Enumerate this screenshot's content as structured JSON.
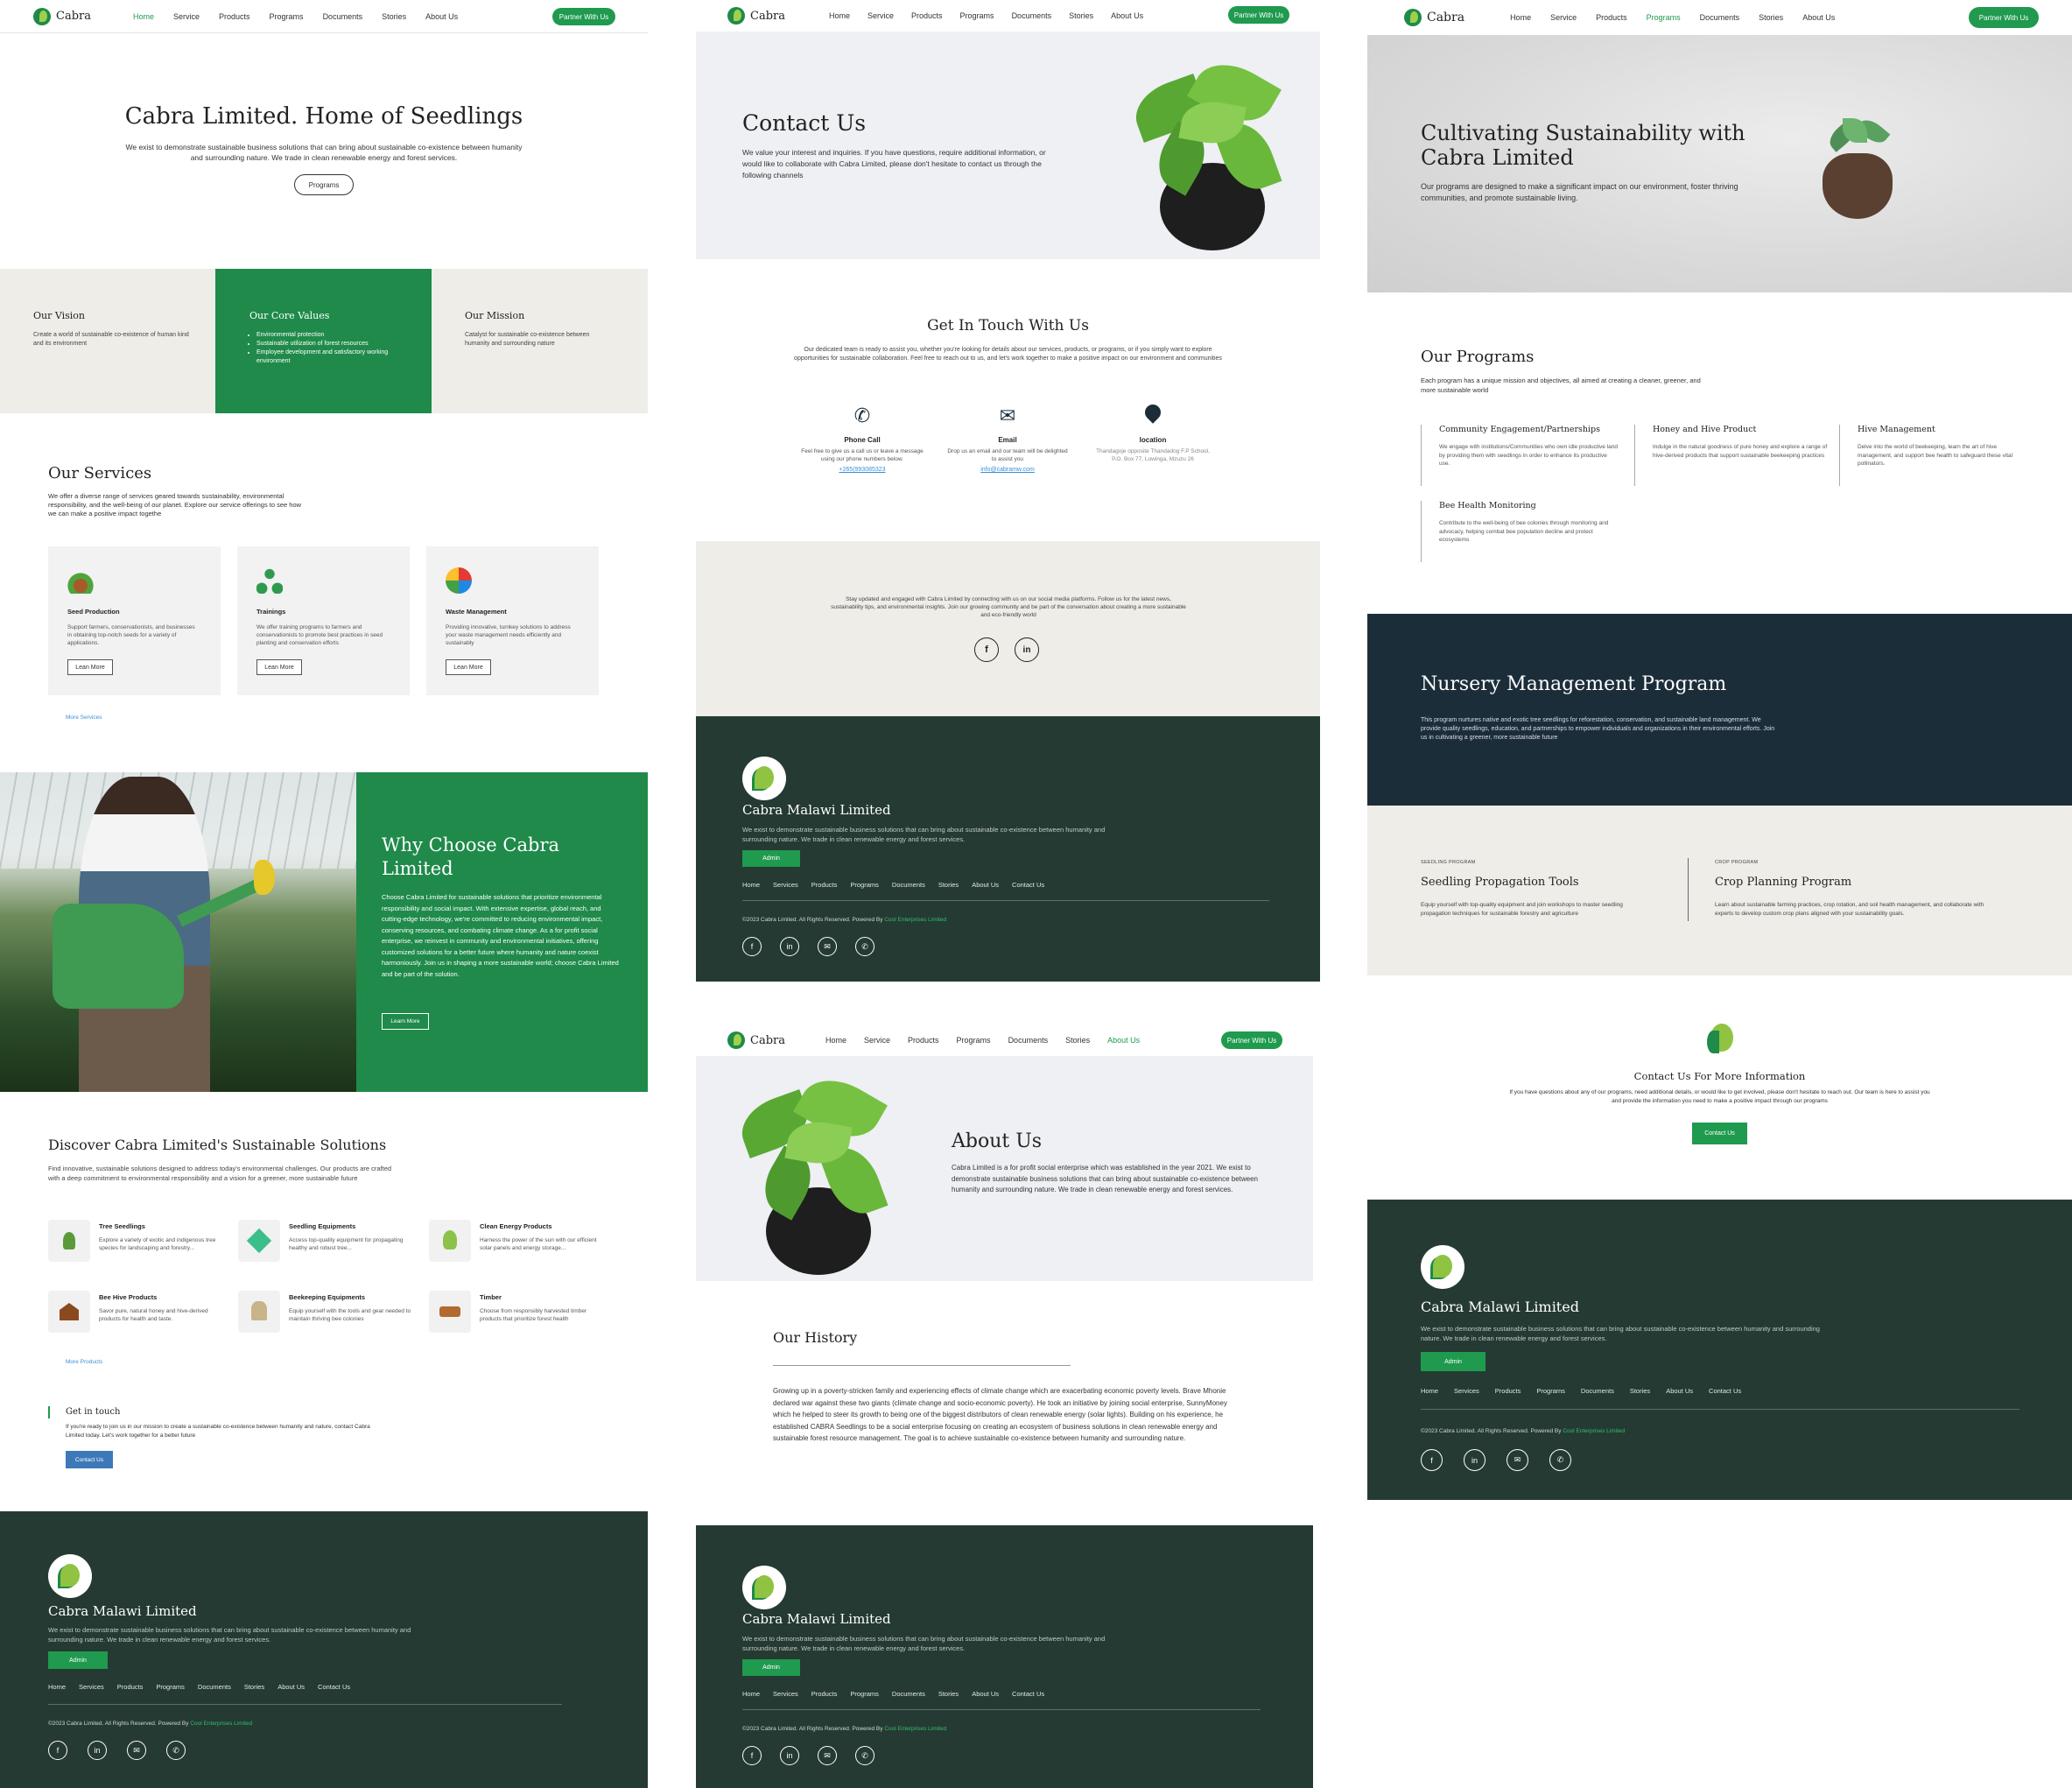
{
  "brand": "Cabra",
  "nav": {
    "links": [
      "Home",
      "Service",
      "Products",
      "Programs",
      "Documents",
      "Stories",
      "About Us"
    ],
    "cta": "Partner With Us"
  },
  "home": {
    "hero_title": "Cabra Limited. Home of Seedlings",
    "hero_desc": "We exist to demonstrate sustainable business solutions that can bring about sustainable co-existence between humanity and surrounding nature. We trade in clean renewable energy and forest services.",
    "hero_btn": "Programs",
    "vision_title": "Our Vision",
    "vision_text": "Create a world of sustainable co-existence of human kind and its environment",
    "core_title": "Our Core Values",
    "core_items": [
      "Environmental protection",
      "Sustainable utilization of forest resources",
      "Employee development and satisfactory working environment"
    ],
    "mission_title": "Our Mission",
    "mission_text": "Catalyst for sustainable co-existence between humanity and surrounding nature",
    "services_title": "Our Services",
    "services_desc": "We offer a diverse range of services geared towards sustainability, environmental responsibility, and the well-being of our planet. Explore our service offerings to see how we can make a positive impact togethe",
    "services": [
      {
        "title": "Seed Production",
        "text": "Support farmers, conservationists, and businesses in obtaining top-notch seeds for a variety of applications.",
        "btn": "Lean More"
      },
      {
        "title": "Trainings",
        "text": "We offer training programs to farmers and conservationists to promote best practices in seed planting and conservation efforts",
        "btn": "Lean More"
      },
      {
        "title": "Waste Management",
        "text": "Providing innovative, turnkey solutions to address your waste management needs efficiently and sustainably",
        "btn": "Lean More"
      }
    ],
    "more_services": "More Services",
    "why_title": "Why Choose Cabra Limited",
    "why_text": "Choose Cabra Limited for sustainable solutions that prioritize environmental responsibility and social impact. With extensive expertise, global reach, and cutting-edge technology, we're committed to reducing environmental impact, conserving resources, and combating climate change. As a for profit social enterprise, we reinvest in community and environmental initiatives, offering customized solutions for a better future where humanity and nature coexist harmoniously. Join us in shaping a more sustainable world; choose Cabra Limited and be part of the solution.",
    "why_btn": "Learn More",
    "discover_title": "Discover Cabra Limited's Sustainable Solutions",
    "discover_desc": "Find innovative, sustainable solutions designed to address today's environmental challenges. Our products are crafted with a deep commitment to environmental responsibility and a vision for a greener, more sustainable future",
    "products": [
      {
        "title": "Tree Seedlings",
        "text": "Explore a variety of exotic and indigenous tree species for landscaping and forestry..."
      },
      {
        "title": "Seedling Equipments",
        "text": "Access top-quality equipment for propagating healthy and robust tree..."
      },
      {
        "title": "Clean Energy Products",
        "text": "Harness the power of the sun with our efficient solar panels and energy storage..."
      },
      {
        "title": "Bee Hive Products",
        "text": "Savor pure, natural honey and hive-derived products for health and taste."
      },
      {
        "title": "Beekeeping Equipments",
        "text": "Equip yourself with the tools and gear needed to maintain thriving bee colonies"
      },
      {
        "title": "Timber",
        "text": "Choose from responsibly harvested timber products that prioritize forest health"
      }
    ],
    "more_products": "More Products",
    "touch_title": "Get in touch",
    "touch_text": "If you're ready to join us in our mission to create a sustainable co-existence between humanity and nature, contact Cabra Limited today. Let's work together for a better future",
    "touch_btn": "Contact Us"
  },
  "contact": {
    "hero_title": "Contact Us",
    "hero_desc": "We value your interest and inquiries. If you have questions, require additional information, or would like to collaborate with Cabra Limited, please don't hesitate to contact us through the following channels",
    "touch_title": "Get In Touch With Us",
    "touch_desc": "Our dedicated team is ready to assist you, whether you're looking for details about our services, products, or programs, or if you simply want to explore opportunities for sustainable collaboration. Feel free to reach out to us, and let's work together to make a positive impact on our environment and communities",
    "channels": [
      {
        "title": "Phone Call",
        "text": "Feel free to give us a call us or leave a message using our phone numbers below.",
        "link": "+265(993085323"
      },
      {
        "title": "Email",
        "text": "Drop us an email and our team will be delighted to assist you",
        "link": "info@cabramw.com"
      },
      {
        "title": "location",
        "text": "Thandagoje opposite Thandadog F.P School, P.O. Box 77, Lowinga, Mzuzu 26",
        "link": ""
      }
    ],
    "social_text": "Stay updated and engaged with Cabra Limited by connecting with us on our social media platforms. Follow us for the latest news, sustainability tips, and environmental insights. Join our growing community and be part of the conversation about creating a more sustainable and eco-friendly world"
  },
  "about": {
    "hero_title": "About Us",
    "hero_desc": "Cabra Limited is a for profit social enterprise which was established in the year 2021. We exist to demonstrate sustainable business solutions that can bring about sustainable co-existence between humanity and surrounding nature. We trade in clean renewable energy and forest services.",
    "history_title": "Our History",
    "history_text": "Growing up in a poverty-stricken family and experiencing effects of climate change which are exacerbating economic poverty levels. Brave Mhonie declared war against these two giants (climate change and socio-economic poverty). He took an initiative by joining social enterprise, SunnyMoney which he helped to steer its growth to being one of the biggest distributors of clean renewable energy (solar lights). Building on his experience, he established CABRA Seedlings to be a social enterprise focusing on creating an ecosystem of business solutions in clean renewable energy and sustainable forest resource management. The goal is to achieve sustainable co-existence between humanity and surrounding nature."
  },
  "programs": {
    "hero_title": "Cultivating Sustainability with Cabra Limited",
    "hero_desc": "Our programs are designed to make a significant impact on our environment, foster thriving communities, and promote sustainable living.",
    "list_title": "Our Programs",
    "list_desc": "Each program has a unique mission and objectives, all aimed at creating a cleaner, greener, and more sustainable world",
    "items": [
      {
        "title": "Community Engagement/Partnerships",
        "text": "We engage with institutions/Communities who own idle productive land by providing them with seedlings in order to enhance its productive use."
      },
      {
        "title": "Honey and Hive Product",
        "text": "Indulge in the natural goodness of pure honey and explore a range of hive-derived products that support sustainable beekeeping practices"
      },
      {
        "title": "Hive Management",
        "text": "Delve into the world of beekeeping, learn the art of hive management, and support bee health to safeguard these vital pollinators."
      },
      {
        "title": "Bee Health Monitoring",
        "text": "Contribute to the well-being of bee colonies through monitoring and advocacy, helping combat bee population decline and protect ecosystems"
      }
    ],
    "nursery_title": "Nursery Management Program",
    "nursery_text": "This program nurtures native and exotic tree seedlings for reforestation, conservation, and sustainable land management. We provide quality seedlings, education, and partnerships to empower individuals and organizations in their environmental efforts. Join us in cultivating a greener, more sustainable future",
    "sub": [
      {
        "tag": "SEEDLING PROGRAM",
        "title": "Seedling Propagation Tools",
        "text": "Equip yourself with top-quality equipment and join workshops to master seedling propagation techniques for sustainable forestry and agriculture"
      },
      {
        "tag": "CROP PROGRAM",
        "title": "Crop Planning Program",
        "text": "Learn about sustainable farming practices, crop rotation, and soil health management, and collaborate with experts to develop custom crop plans aligned with your sustainability goals."
      }
    ],
    "contact_title": "Contact Us For More Information",
    "contact_text": "If you have questions about any of our programs, need additional details, or would like to get involved, please don't hesitate to reach out. Our team is here to assist you and provide the information you need to make a positive impact through our programs",
    "contact_btn": "Contact Us"
  },
  "footer": {
    "title": "Cabra Malawi Limited",
    "desc": "We exist to demonstrate sustainable business solutions that can bring about sustainable co-existence between humanity and surrounding nature. We trade in clean renewable energy and forest services.",
    "btn": "Admin",
    "links": [
      "Home",
      "Services",
      "Products",
      "Programs",
      "Documents",
      "Stories",
      "About Us",
      "Contact Us"
    ],
    "copy": "©2023 Cabra Limited. All Rights Reserved. Powered By",
    "powered": "Cool Enterprises Limited"
  },
  "colors": {
    "green": "#1f9a4e",
    "dark_green": "#253a33",
    "navy": "#1c2d3a",
    "beige": "#eeede8"
  }
}
